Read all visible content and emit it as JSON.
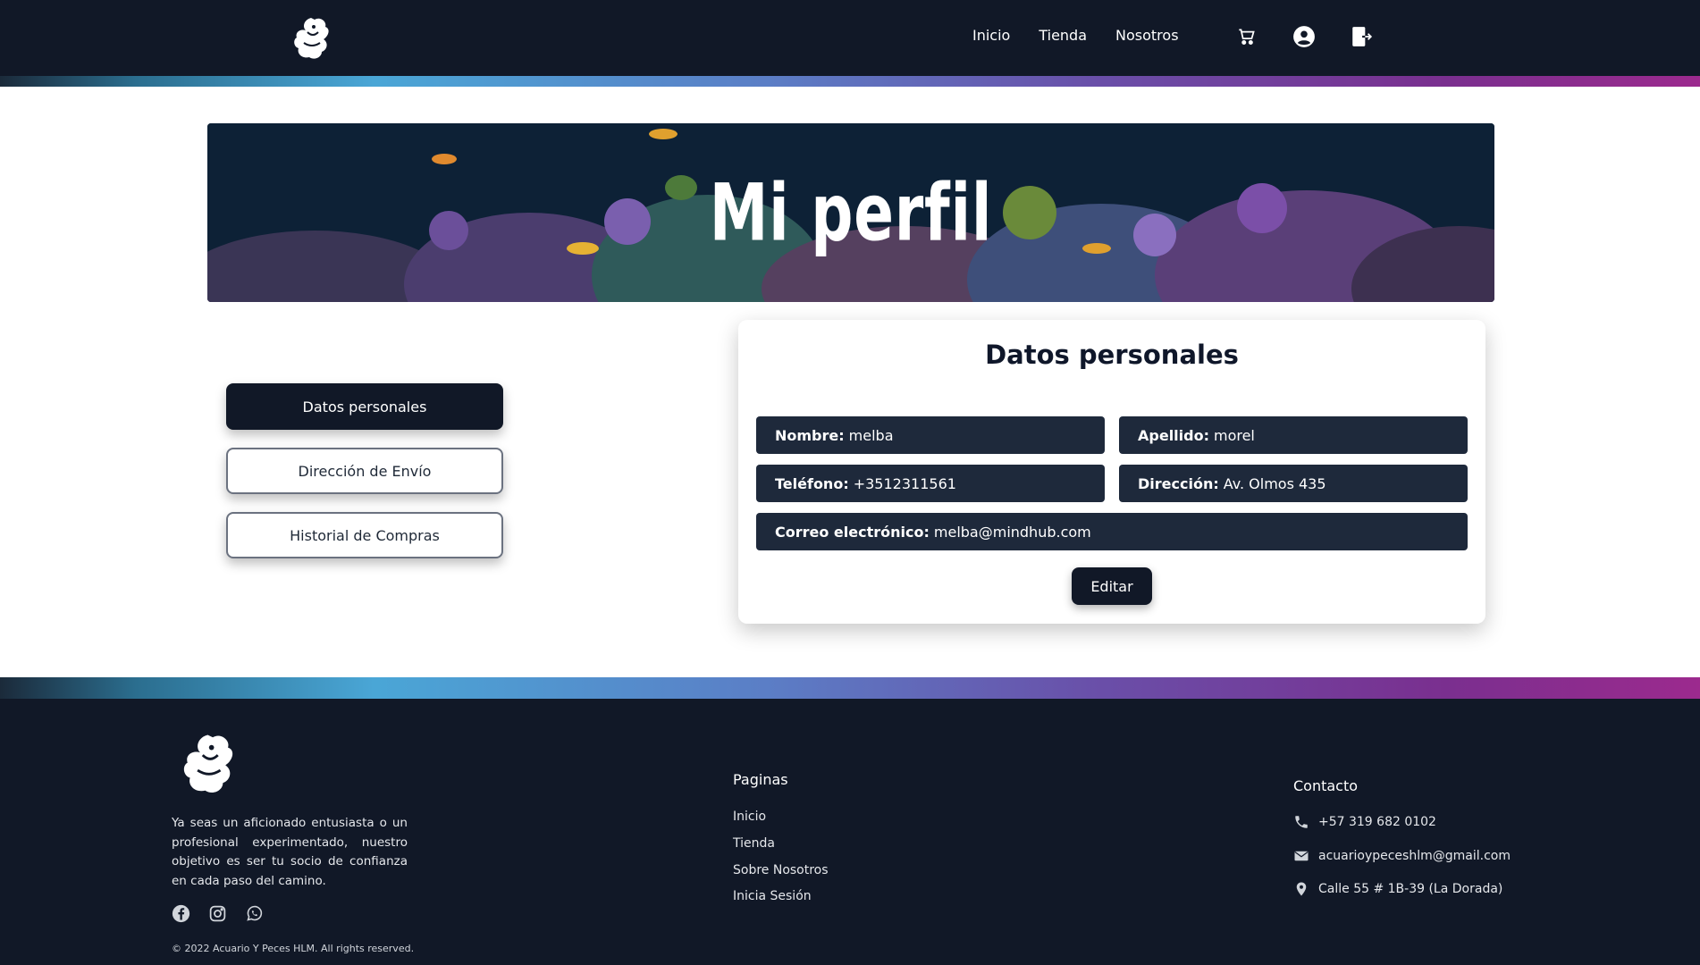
{
  "nav": {
    "items": [
      "Inicio",
      "Tienda",
      "Nosotros"
    ]
  },
  "banner": {
    "title": "Mi perfil"
  },
  "tabs": [
    {
      "label": "Datos personales",
      "active": true
    },
    {
      "label": "Dirección de Envío",
      "active": false
    },
    {
      "label": "Historial de Compras",
      "active": false
    }
  ],
  "personal": {
    "title": "Datos personales",
    "fields": {
      "nombre": {
        "label": "Nombre:",
        "value": "melba"
      },
      "apellido": {
        "label": "Apellido:",
        "value": "morel"
      },
      "telefono": {
        "label": "Teléfono:",
        "value": "+3512311561"
      },
      "direccion": {
        "label": "Dirección:",
        "value": "Av. Olmos 435"
      },
      "correo": {
        "label": "Correo electrónico:",
        "value": "melba@mindhub.com"
      }
    },
    "edit_label": "Editar"
  },
  "footer": {
    "description": "Ya seas un aficionado entusiasta o un profesional experimentado, nuestro objetivo es ser tu socio de confianza en cada paso del camino.",
    "copyright": "© 2022 Acuario Y Peces HLM. All rights reserved.",
    "pages_title": "Paginas",
    "pages": [
      "Inicio",
      "Tienda",
      "Sobre Nosotros",
      "Inicia Sesión"
    ],
    "contact_title": "Contacto",
    "contact": {
      "phone": "+57 319 682 0102",
      "email": "acuarioypeceshlm@gmail.com",
      "address": "Calle 55 # 1B-39 (La Dorada)"
    }
  },
  "colors": {
    "dark": "#111827",
    "field": "#1e293b",
    "accent_blue": "#4aa6d6",
    "accent_purple": "#9c2a8e"
  },
  "icons": [
    "cart-icon",
    "user-circle-icon",
    "logout-icon",
    "facebook-icon",
    "instagram-icon",
    "whatsapp-icon",
    "phone-icon",
    "mail-icon",
    "location-pin-icon"
  ]
}
